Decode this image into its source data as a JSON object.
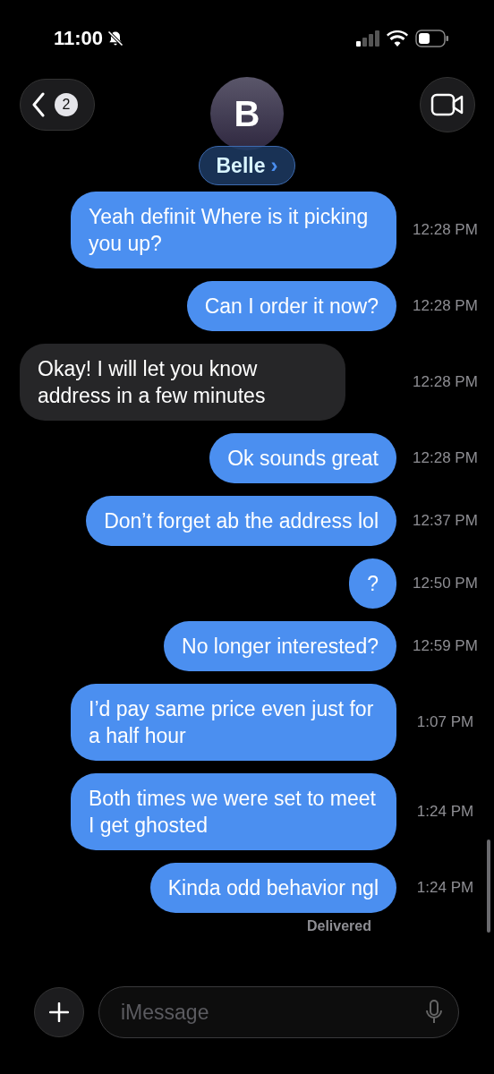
{
  "status_bar": {
    "time": "11:00",
    "silent": true
  },
  "header": {
    "back_badge": "2",
    "avatar_initial": "B",
    "contact_name": "Belle",
    "name_chevron": "›"
  },
  "messages": [
    {
      "kind": "sent",
      "text": "Yeah definit Where is it picking you up?",
      "time": "12:28 PM"
    },
    {
      "kind": "sent",
      "text": "Can I order it now?",
      "time": "12:28 PM"
    },
    {
      "kind": "received",
      "text": "Okay!  I will let you know address in a few minutes",
      "time": "12:28 PM"
    },
    {
      "kind": "sent",
      "text": "Ok sounds great",
      "time": "12:28 PM"
    },
    {
      "kind": "sent",
      "text": "Don’t forget ab the address lol",
      "time": "12:37 PM"
    },
    {
      "kind": "sent",
      "text": "?",
      "time": "12:50 PM"
    },
    {
      "kind": "sent",
      "text": "No longer interested?",
      "time": "12:59 PM"
    },
    {
      "kind": "sent",
      "text": "I’d pay same price even just for a half hour",
      "time": "1:07 PM"
    },
    {
      "kind": "sent",
      "text": "Both times we were set to meet I get ghosted",
      "time": "1:24 PM"
    },
    {
      "kind": "sent",
      "text": "Kinda odd behavior ngl",
      "time": "1:24 PM"
    }
  ],
  "delivery_status": "Delivered",
  "composer": {
    "placeholder": "iMessage"
  }
}
